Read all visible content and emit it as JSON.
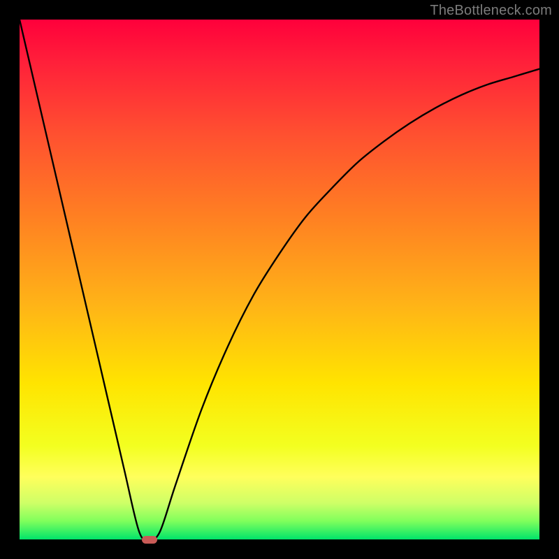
{
  "watermark": "TheBottleneck.com",
  "chart_data": {
    "type": "line",
    "title": "",
    "xlabel": "",
    "ylabel": "",
    "xlim": [
      0,
      100
    ],
    "ylim": [
      0,
      100
    ],
    "grid": false,
    "legend": false,
    "series": [
      {
        "name": "bottleneck-curve",
        "x": [
          0,
          5,
          10,
          15,
          20,
          23,
          25,
          27,
          30,
          35,
          40,
          45,
          50,
          55,
          60,
          65,
          70,
          75,
          80,
          85,
          90,
          95,
          100
        ],
        "values": [
          100,
          78.5,
          57,
          35.5,
          14,
          1.5,
          0,
          1.5,
          10.5,
          25,
          37,
          47,
          55,
          62,
          67.5,
          72.5,
          76.5,
          80,
          83,
          85.5,
          87.5,
          89,
          90.5
        ]
      }
    ],
    "minimum_marker": {
      "x": 25,
      "y": 0
    },
    "background_gradient_meaning": "red=high bottleneck, green=optimal"
  }
}
